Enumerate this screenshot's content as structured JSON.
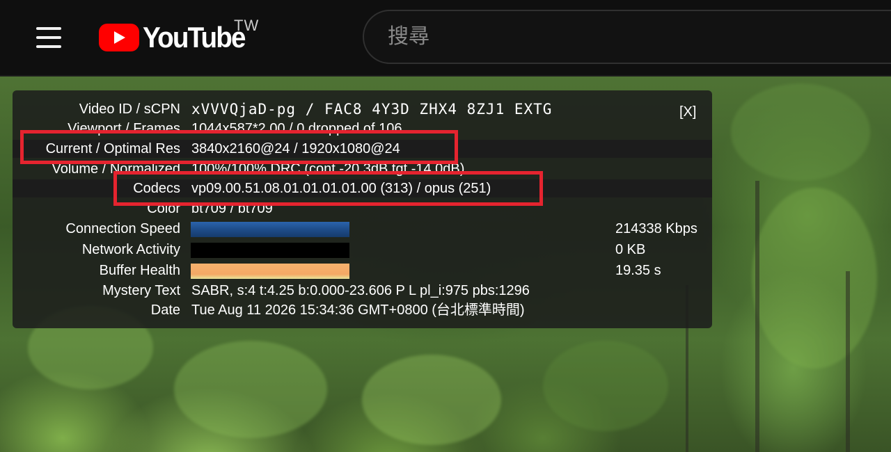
{
  "masthead": {
    "logo_text": "YouTube",
    "country_code": "TW",
    "search_placeholder": "搜尋"
  },
  "stats": {
    "close_label": "[X]",
    "rows": {
      "video_id": {
        "label": "Video ID / sCPN",
        "value": "xVVVQjaD-pg / FAC8 4Y3D ZHX4 8ZJ1 EXTG"
      },
      "viewport": {
        "label": "Viewport / Frames",
        "value": "1044x587*2.00 / 0 dropped of 106"
      },
      "resolution": {
        "label": "Current / Optimal Res",
        "value": "3840x2160@24 / 1920x1080@24"
      },
      "volume": {
        "label": "Volume / Normalized",
        "value": "100%/100% DRC (cont -20.3dB tgt -14.0dB)"
      },
      "codecs": {
        "label": "Codecs",
        "value": "vp09.00.51.08.01.01.01.01.00 (313) / opus (251)"
      },
      "color": {
        "label": "Color",
        "value": "bt709 / bt709"
      },
      "connection": {
        "label": "Connection Speed",
        "value": "214338 Kbps",
        "color": "#1f4e8c"
      },
      "network": {
        "label": "Network Activity",
        "value": "0 KB",
        "color": "#000000"
      },
      "buffer": {
        "label": "Buffer Health",
        "value": "19.35 s",
        "color": "#f4a865"
      },
      "mystery": {
        "label": "Mystery Text",
        "value": "SABR, s:4 t:4.25 b:0.000-23.606 P L pl_i:975 pbs:1296"
      },
      "date": {
        "label": "Date",
        "value": "Tue Aug 11 2026 15:34:36 GMT+0800 (台北標準時間)"
      }
    }
  },
  "colors": {
    "highlight": "#e5242f",
    "brand_red": "#ff0000",
    "masthead_bg": "#0f0f0f"
  },
  "icons": {
    "menu": "hamburger-menu-icon",
    "logo": "youtube-play-icon"
  }
}
